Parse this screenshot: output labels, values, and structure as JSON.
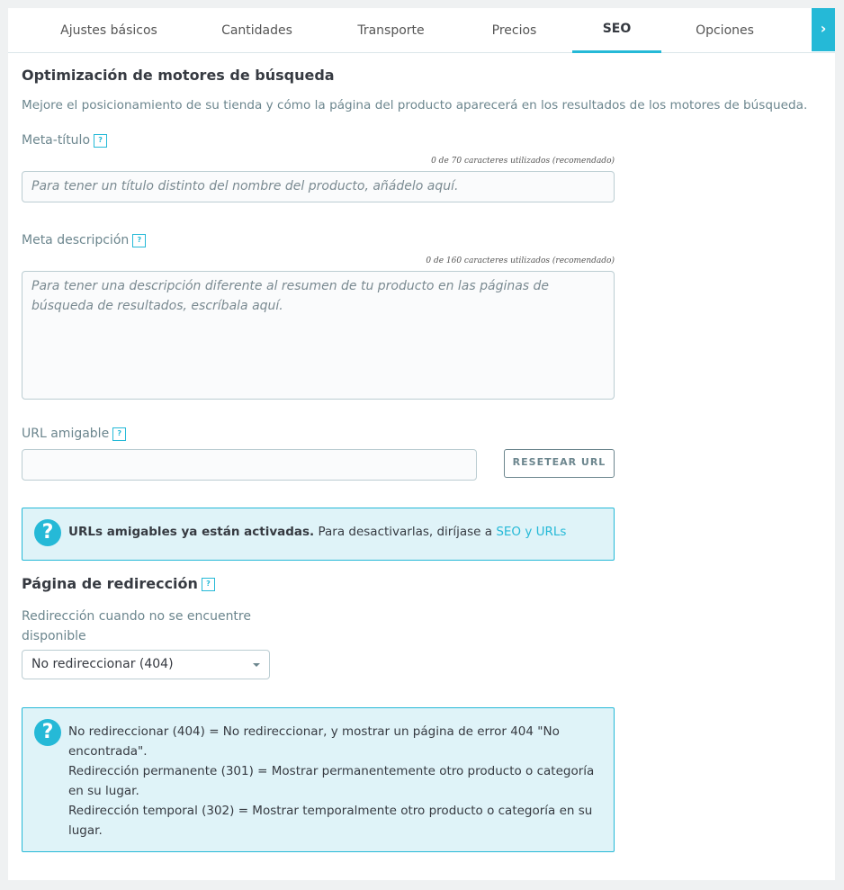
{
  "tabs": [
    {
      "label": "Ajustes básicos"
    },
    {
      "label": "Cantidades"
    },
    {
      "label": "Transporte"
    },
    {
      "label": "Precios"
    },
    {
      "label": "SEO"
    },
    {
      "label": "Opciones"
    }
  ],
  "tabs_next_glyph": "›",
  "seo": {
    "title": "Optimización de motores de búsqueda",
    "description": "Mejore el posicionamiento de su tienda y cómo la página del producto aparecerá en los resultados de los motores de búsqueda."
  },
  "help_glyph": "?",
  "meta_title": {
    "label": "Meta-título",
    "counter": "0 de 70 caracteres utilizados (recomendado)",
    "placeholder": "Para tener un título distinto del nombre del producto, añádelo aquí.",
    "value": ""
  },
  "meta_description": {
    "label": "Meta descripción",
    "counter": "0 de 160 caracteres utilizados (recomendado)",
    "placeholder": "Para tener una descripción diferente al resumen de tu producto en las páginas de búsqueda de resultados, escríbala aquí.",
    "value": ""
  },
  "friendly_url": {
    "label": "URL amigable",
    "value": "",
    "reset_button": "RESETEAR URL"
  },
  "url_alert": {
    "icon": "?",
    "bold": "URLs amigables ya están activadas.",
    "text": " Para desactivarlas, diríjase a ",
    "link": "SEO y URLs"
  },
  "redirect": {
    "title": "Página de redirección",
    "label": "Redirección cuando no se encuentre disponible",
    "selected": "No redireccionar (404)"
  },
  "redirect_alert": {
    "icon": "?",
    "lines": [
      "No redireccionar (404) = No redireccionar, y mostrar un página de error 404 \"No encontrada\".",
      "Redirección permanente (301) = Mostrar permanentemente otro producto o categoría en su lugar.",
      "Redirección temporal (302) = Mostrar temporalmente otro producto o categoría en su lugar."
    ]
  },
  "colors": {
    "accent": "#25b9d7",
    "alert_bg": "#dff3f8",
    "page_bg": "#eff1f2"
  }
}
